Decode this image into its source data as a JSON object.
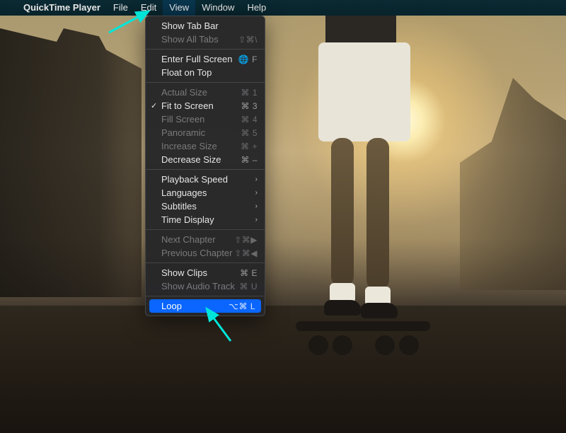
{
  "menubar": {
    "appname": "QuickTime Player",
    "items": [
      "File",
      "Edit",
      "View",
      "Window",
      "Help"
    ],
    "open_index": 2
  },
  "dropdown": {
    "groups": [
      [
        {
          "label": "Show Tab Bar",
          "shortcut": "",
          "enabled": true
        },
        {
          "label": "Show All Tabs",
          "shortcut": "⇧⌘\\",
          "enabled": false
        }
      ],
      [
        {
          "label": "Enter Full Screen",
          "shortcut": "🌐 F",
          "enabled": true
        },
        {
          "label": "Float on Top",
          "shortcut": "",
          "enabled": true
        }
      ],
      [
        {
          "label": "Actual Size",
          "shortcut": "⌘ 1",
          "enabled": false
        },
        {
          "label": "Fit to Screen",
          "shortcut": "⌘ 3",
          "enabled": true,
          "checked": true
        },
        {
          "label": "Fill Screen",
          "shortcut": "⌘ 4",
          "enabled": false
        },
        {
          "label": "Panoramic",
          "shortcut": "⌘ 5",
          "enabled": false
        },
        {
          "label": "Increase Size",
          "shortcut": "⌘ +",
          "enabled": false
        },
        {
          "label": "Decrease Size",
          "shortcut": "⌘ –",
          "enabled": true
        }
      ],
      [
        {
          "label": "Playback Speed",
          "submenu": true,
          "enabled": true
        },
        {
          "label": "Languages",
          "submenu": true,
          "enabled": true
        },
        {
          "label": "Subtitles",
          "submenu": true,
          "enabled": true
        },
        {
          "label": "Time Display",
          "submenu": true,
          "enabled": true
        }
      ],
      [
        {
          "label": "Next Chapter",
          "shortcut": "⇧⌘▶",
          "enabled": false
        },
        {
          "label": "Previous Chapter",
          "shortcut": "⇧⌘◀",
          "enabled": false
        }
      ],
      [
        {
          "label": "Show Clips",
          "shortcut": "⌘ E",
          "enabled": true
        },
        {
          "label": "Show Audio Track",
          "shortcut": "⌘ U",
          "enabled": false
        }
      ],
      [
        {
          "label": "Loop",
          "shortcut": "⌥⌘ L",
          "enabled": true,
          "highlight": true
        }
      ]
    ]
  },
  "annotations": {
    "arrow_color": "#00e5d8"
  }
}
